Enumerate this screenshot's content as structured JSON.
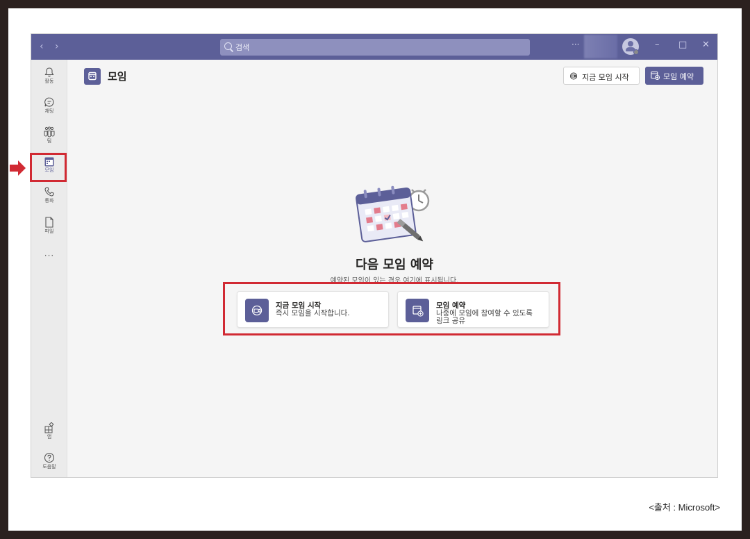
{
  "window": {
    "search_placeholder": "검색",
    "more": "···",
    "controls": {
      "minimize": "–",
      "maximize": "□",
      "close": "✕"
    }
  },
  "rail": {
    "items": [
      {
        "label": "활동",
        "icon": "bell-icon"
      },
      {
        "label": "채팅",
        "icon": "chat-icon"
      },
      {
        "label": "팀",
        "icon": "teams-icon"
      },
      {
        "label": "모임",
        "icon": "calendar-icon"
      },
      {
        "label": "통화",
        "icon": "phone-icon"
      },
      {
        "label": "파일",
        "icon": "file-icon"
      }
    ],
    "more": "···",
    "bottom": [
      {
        "label": "앱",
        "icon": "apps-icon"
      },
      {
        "label": "도움말",
        "icon": "help-icon"
      }
    ]
  },
  "header": {
    "title": "모임",
    "meet_now_label": "지금 모임 시작",
    "schedule_label": "모임 예약"
  },
  "empty_state": {
    "title": "다음 모임 예약",
    "subtitle": "예약된 모임이 있는 경우 여기에 표시됩니다.",
    "cards": [
      {
        "title": "지금 모임 시작",
        "description": "즉시 모임을 시작합니다."
      },
      {
        "title": "모임 예약",
        "description": "나중에 모임에 참여할 수 있도록 링크 공유"
      }
    ]
  },
  "caption": "<출처 : Microsoft>",
  "colors": {
    "brand": "#5c5f98",
    "highlight": "#d12a33",
    "background": "#2b211f"
  }
}
